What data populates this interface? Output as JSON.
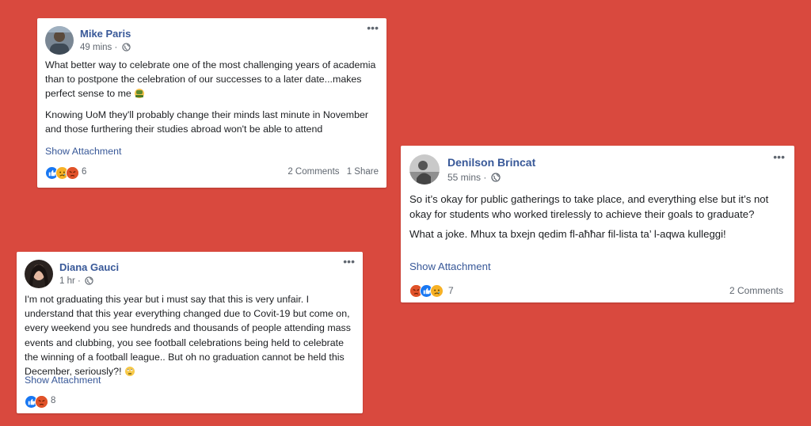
{
  "colors": {
    "background": "#d9493e",
    "card": "#ffffff",
    "name": "#385898",
    "link": "#385898",
    "meta": "#606770",
    "text": "#1c1e21",
    "like": "#1877f2",
    "angry": "#e9710f",
    "sad": "#f7b125"
  },
  "posts": [
    {
      "author": "Mike Paris",
      "time": "49 mins ·",
      "privacy_icon": "globe-icon",
      "paragraphs": [
        "What better way to celebrate one of the most challenging years of academia than to postpone the celebration of our successes to a later date...makes perfect sense to me",
        "Knowing UoM they'll probably change their minds last minute in November and those furthering their studies abroad won't be able to attend"
      ],
      "inline_emoji": "facepalm-emoji",
      "attachment_label": "Show Attachment",
      "reactions": [
        "like",
        "sad",
        "angry"
      ],
      "reaction_count": "6",
      "comments": "2 Comments",
      "shares": "1 Share"
    },
    {
      "author": "Denilson Brincat",
      "time": "55 mins ·",
      "privacy_icon": "globe-icon",
      "paragraphs": [
        "So it’s okay for public gatherings to take place, and everything else but it’s not okay for students who worked tirelessly to achieve their goals to graduate?",
        "What a joke. Mhux ta bxejn qedim fl-aħħar fil-lista ta’ l-aqwa kulleggi!"
      ],
      "attachment_label": "Show Attachment",
      "reactions": [
        "angry",
        "like",
        "sad"
      ],
      "reaction_count": "7",
      "comments": "2 Comments"
    },
    {
      "author": "Diana Gauci",
      "time": "1 hr ·",
      "privacy_icon": "globe-icon",
      "paragraphs": [
        "I'm not graduating this year but i must say that this is very unfair. I understand that this year everything changed due to Covit-19 but come on, every weekend you see hundreds and thousands of people attending mass events and clubbing, you see football celebrations being held to celebrate the winning of a football league.. But oh no graduation cannot be held this December, seriously?!"
      ],
      "inline_emoji": "eye-roll-emoji",
      "attachment_label": "Show Attachment",
      "reactions": [
        "like",
        "angry"
      ],
      "reaction_count": "8"
    }
  ]
}
